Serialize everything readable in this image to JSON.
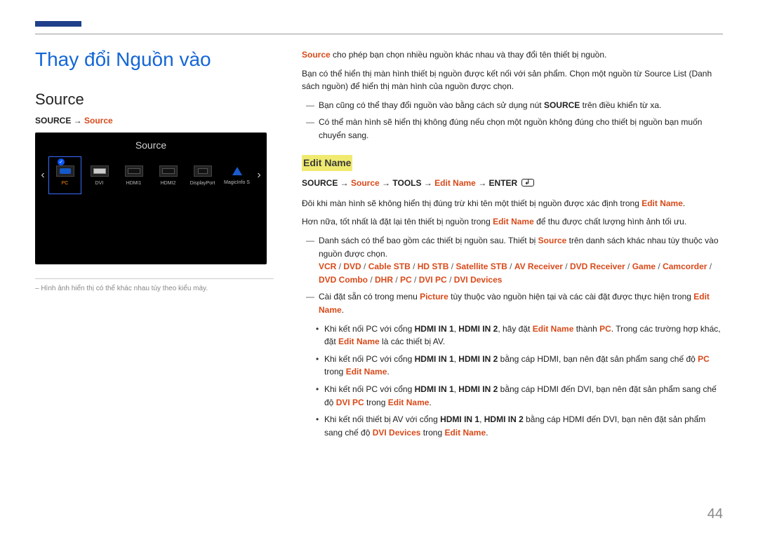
{
  "page_number": "44",
  "title": "Thay đổi Nguồn vào",
  "left": {
    "section_title": "Source",
    "path": {
      "part1": "SOURCE",
      "arrow1": " → ",
      "part2": "Source"
    },
    "osd": {
      "title": "Source",
      "nav_prev": "‹",
      "nav_next": "›",
      "items": [
        {
          "label": "PC",
          "selected": true,
          "icon": "vga-icon"
        },
        {
          "label": "DVI",
          "selected": false,
          "icon": "dvi-icon"
        },
        {
          "label": "HDMI1",
          "selected": false,
          "icon": "hdmi-icon"
        },
        {
          "label": "HDMI2",
          "selected": false,
          "icon": "hdmi-icon"
        },
        {
          "label": "DisplayPort",
          "selected": false,
          "icon": "dp-icon"
        },
        {
          "label": "MagicInfo S",
          "selected": false,
          "icon": "magicinfo-icon"
        }
      ]
    },
    "note": "– Hình ảnh hiển thị có thể khác nhau tùy theo kiểu máy."
  },
  "right": {
    "intro_pre": "Source",
    "intro_post": " cho phép bạn chọn nhiều nguồn khác nhau và thay đổi tên thiết bị nguồn.",
    "para2": "Bạn có thể hiển thị màn hình thiết bị nguồn được kết nối với sản phẩm. Chọn một nguồn từ Source List (Danh sách nguồn) để hiển thị màn hình của nguồn được chọn.",
    "dash1a": "Bạn cũng có thể thay đổi nguồn vào bằng cách sử dụng nút ",
    "dash1b": "SOURCE",
    "dash1c": " trên điều khiển từ xa.",
    "dash2": "Có thể màn hình sẽ hiển thị không đúng nếu chọn một nguồn không đúng cho thiết bị nguồn bạn muốn chuyển sang.",
    "subheading": "Edit Name",
    "path2": {
      "p1": "SOURCE",
      "a1": " → ",
      "p2": "Source",
      "a2": " → ",
      "p3": "TOOLS",
      "a3": " → ",
      "p4": "Edit Name",
      "a4": " → ",
      "p5": "ENTER"
    },
    "para3a": "Đôi khi màn hình sẽ không hiển thị đúng trừ khi tên một thiết bị nguồn được xác định trong ",
    "para3b": "Edit Name",
    "para3c": ".",
    "para4a": "Hơn nữa, tốt nhất là đặt lại tên thiết bị nguồn trong ",
    "para4b": "Edit Name",
    "para4c": " để thu được chất lượng hình ảnh tối ưu.",
    "dash3a": "Danh sách có thể bao gồm các thiết bị nguồn sau. Thiết bị ",
    "dash3b": "Source",
    "dash3c": " trên danh sách khác nhau tùy thuộc vào nguồn được chọn.",
    "devices": [
      "VCR",
      "DVD",
      "Cable STB",
      "HD STB",
      "Satellite STB",
      "AV Receiver",
      "DVD Receiver",
      "Game",
      "Camcorder",
      "DVD Combo",
      "DHR",
      "PC",
      "DVI PC",
      "DVI Devices"
    ],
    "dash4a": "Cài đặt sẵn có trong menu ",
    "dash4b": "Picture",
    "dash4c": " tùy thuộc vào nguồn hiện tại và các cài đặt được thực hiện trong ",
    "dash4d": "Edit Name",
    "dash4e": ".",
    "b1a": "Khi kết nối PC với cổng ",
    "b1b": "HDMI IN 1",
    "b1c": ", ",
    "b1d": "HDMI IN 2",
    "b1e": ", hãy đặt ",
    "b1f": "Edit Name",
    "b1g": " thành ",
    "b1h": "PC",
    "b1i": ". Trong các trường hợp khác, đặt ",
    "b1j": "Edit Name",
    "b1k": " là các thiết bị AV.",
    "b2a": "Khi kết nối PC với cổng ",
    "b2b": "HDMI IN 1",
    "b2c": ", ",
    "b2d": "HDMI IN 2",
    "b2e": " bằng cáp HDMI, bạn nên đặt sản phẩm sang chế độ ",
    "b2f": "PC",
    "b2g": " trong ",
    "b2h": "Edit Name",
    "b2i": ".",
    "b3a": "Khi kết nối PC với cổng ",
    "b3b": "HDMI IN 1",
    "b3c": ", ",
    "b3d": "HDMI IN 2",
    "b3e": " bằng cáp HDMI đến DVI, bạn nên đặt sản phẩm sang chế độ ",
    "b3f": "DVI PC",
    "b3g": " trong ",
    "b3h": "Edit Name",
    "b3i": ".",
    "b4a": "Khi kết nối thiết bị AV với cổng ",
    "b4b": "HDMI IN 1",
    "b4c": ", ",
    "b4d": "HDMI IN 2",
    "b4e": " bằng cáp HDMI đến DVI, bạn nên đặt sản phẩm sang chế độ ",
    "b4f": "DVI Devices",
    "b4g": " trong ",
    "b4h": "Edit Name",
    "b4i": "."
  }
}
